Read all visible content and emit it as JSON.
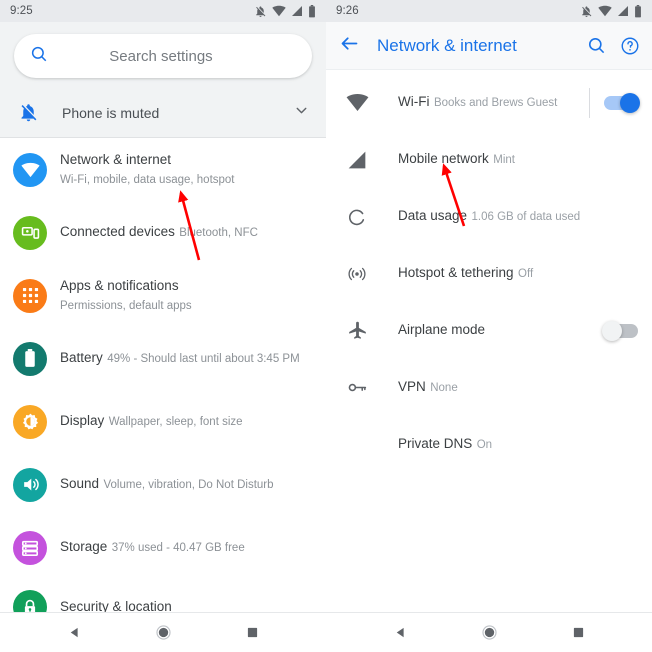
{
  "left_panel": {
    "status_bar": {
      "clock": "9:25",
      "icons": [
        "notifications-off-icon",
        "wifi-icon",
        "signal-icon",
        "battery-icon"
      ]
    },
    "search": {
      "placeholder": "Search settings",
      "icon": "search-icon"
    },
    "muted_row": {
      "label": "Phone is muted",
      "icon": "notifications-off-icon",
      "chevron": "chevron-down-icon"
    },
    "settings": [
      {
        "title": "Network & internet",
        "subtitle": "Wi-Fi, mobile, data usage, hotspot",
        "icon": "wifi-icon",
        "color": "#2196f3"
      },
      {
        "title": "Connected devices",
        "subtitle": "Bluetooth, NFC",
        "icon": "devices-icon",
        "color": "#67bc1e"
      },
      {
        "title": "Apps & notifications",
        "subtitle": "Permissions, default apps",
        "icon": "apps-grid-icon",
        "color": "#fa7b17"
      },
      {
        "title": "Battery",
        "subtitle": "49% - Should last until about 3:45 PM",
        "icon": "battery-icon",
        "color": "#137a6e"
      },
      {
        "title": "Display",
        "subtitle": "Wallpaper, sleep, font size",
        "icon": "brightness-icon",
        "color": "#f9a825"
      },
      {
        "title": "Sound",
        "subtitle": "Volume, vibration, Do Not Disturb",
        "icon": "volume-icon",
        "color": "#13a5a0"
      },
      {
        "title": "Storage",
        "subtitle": "37% used - 40.47 GB free",
        "icon": "storage-icon",
        "color": "#c452dd"
      },
      {
        "title": "Security & location",
        "subtitle": "",
        "icon": "lock-icon",
        "color": "#11a05a"
      }
    ],
    "nav_bar": {
      "back": "back-triangle-icon",
      "home": "home-circle-icon",
      "recents": "recents-square-icon"
    }
  },
  "right_panel": {
    "status_bar": {
      "clock": "9:26",
      "icons": [
        "notifications-off-icon",
        "wifi-icon",
        "signal-icon",
        "battery-icon"
      ]
    },
    "app_bar": {
      "back_icon": "arrow-back-icon",
      "title": "Network & internet",
      "search_icon": "search-icon",
      "help_icon": "help-circle-icon"
    },
    "items": [
      {
        "title": "Wi-Fi",
        "subtitle": "Books and Brews Guest",
        "icon": "wifi-icon",
        "trailing": "toggle-on"
      },
      {
        "title": "Mobile network",
        "subtitle": "Mint",
        "icon": "signal-icon",
        "trailing": "none"
      },
      {
        "title": "Data usage",
        "subtitle": "1.06 GB of data used",
        "icon": "data-usage-icon",
        "trailing": "none"
      },
      {
        "title": "Hotspot & tethering",
        "subtitle": "Off",
        "icon": "hotspot-icon",
        "trailing": "none"
      },
      {
        "title": "Airplane mode",
        "subtitle": "",
        "icon": "airplane-icon",
        "trailing": "toggle-off"
      },
      {
        "title": "VPN",
        "subtitle": "None",
        "icon": "vpn-key-icon",
        "trailing": "none"
      },
      {
        "title": "Private DNS",
        "subtitle": "On",
        "icon": "none",
        "trailing": "none"
      }
    ],
    "nav_bar": {
      "back": "back-triangle-icon",
      "home": "home-circle-icon",
      "recents": "recents-square-icon"
    }
  },
  "annotations": {
    "accent_color": "#ff0000",
    "arrows": [
      {
        "name": "arrow-to-network-internet",
        "points_to": "Network & internet"
      },
      {
        "name": "arrow-to-mobile-network",
        "points_to": "Mobile network"
      }
    ]
  }
}
